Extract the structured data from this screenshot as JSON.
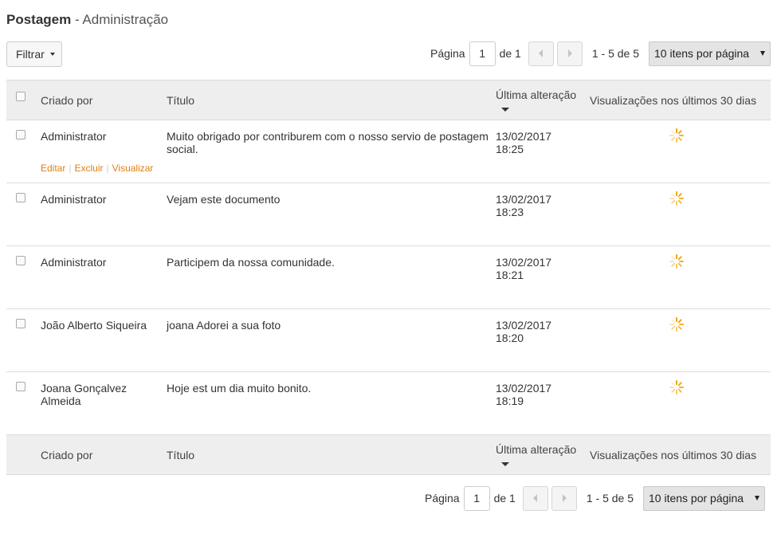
{
  "header": {
    "title_strong": "Postagem",
    "title_rest": " - Administração"
  },
  "filter": {
    "label": "Filtrar"
  },
  "pagination": {
    "page_label": "Página",
    "current_page": "1",
    "of_label": "de 1",
    "range": "1 - 5 de 5",
    "per_page": "10 itens por página"
  },
  "table": {
    "columns": {
      "author": "Criado por",
      "title": "Título",
      "date": "Última alteração",
      "views": "Visualizações nos últimos 30 dias"
    },
    "row_actions": {
      "edit": "Editar",
      "delete": "Excluir",
      "view": "Visualizar"
    },
    "rows": [
      {
        "author": "Administrator",
        "title": "Muito obrigado por contriburem com o nosso servio de postagem social.",
        "date": "13/02/2017",
        "time": "18:25"
      },
      {
        "author": "Administrator",
        "title": "Vejam este documento",
        "date": "13/02/2017",
        "time": "18:23"
      },
      {
        "author": "Administrator",
        "title": "Participem da nossa comunidade.",
        "date": "13/02/2017",
        "time": "18:21"
      },
      {
        "author": "João Alberto Siqueira",
        "title": "joana Adorei a sua foto",
        "date": "13/02/2017",
        "time": "18:20"
      },
      {
        "author": "Joana Gonçalvez Almeida",
        "title": "Hoje est um dia muito bonito.",
        "date": "13/02/2017",
        "time": "18:19"
      }
    ]
  },
  "icons": {
    "spinner": "loading-spinner-icon",
    "prev": "chevron-left-icon",
    "next": "chevron-right-icon",
    "dropdown": "caret-down-icon",
    "sort": "sort-desc-icon"
  },
  "colors": {
    "accent_link": "#e07f10",
    "spinner": "#f0a500",
    "header_bg": "#eeeeee"
  }
}
